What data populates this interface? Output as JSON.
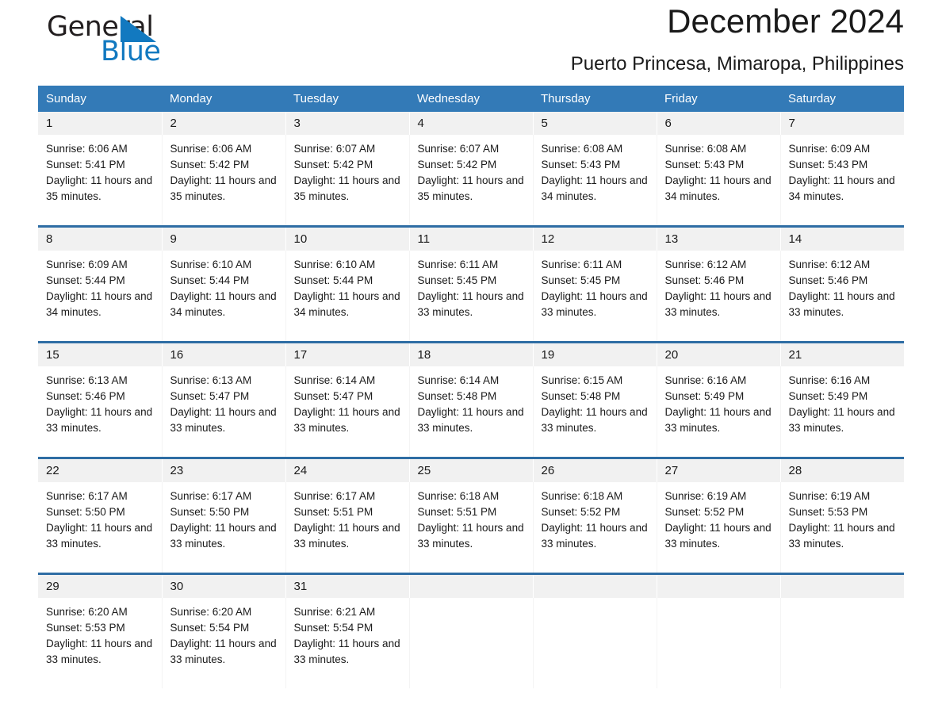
{
  "brand": {
    "name_part1": "General",
    "name_part2": "Blue",
    "triangle_color": "#1279c0",
    "text_color": "#231f20"
  },
  "header": {
    "title": "December 2024",
    "subtitle": "Puerto Princesa, Mimaropa, Philippines"
  },
  "theme": {
    "header_background": "#337ab7",
    "header_text": "#ffffff",
    "week_divider": "#2e6da4",
    "daynum_background": "#f1f1f1",
    "cell_background": "#ffffff",
    "body_text": "#1a1a1a"
  },
  "weekdays": [
    "Sunday",
    "Monday",
    "Tuesday",
    "Wednesday",
    "Thursday",
    "Friday",
    "Saturday"
  ],
  "weeks": [
    {
      "days": [
        {
          "date": "1",
          "sunrise": "Sunrise: 6:06 AM",
          "sunset": "Sunset: 5:41 PM",
          "daylight": "Daylight: 11 hours and 35 minutes."
        },
        {
          "date": "2",
          "sunrise": "Sunrise: 6:06 AM",
          "sunset": "Sunset: 5:42 PM",
          "daylight": "Daylight: 11 hours and 35 minutes."
        },
        {
          "date": "3",
          "sunrise": "Sunrise: 6:07 AM",
          "sunset": "Sunset: 5:42 PM",
          "daylight": "Daylight: 11 hours and 35 minutes."
        },
        {
          "date": "4",
          "sunrise": "Sunrise: 6:07 AM",
          "sunset": "Sunset: 5:42 PM",
          "daylight": "Daylight: 11 hours and 35 minutes."
        },
        {
          "date": "5",
          "sunrise": "Sunrise: 6:08 AM",
          "sunset": "Sunset: 5:43 PM",
          "daylight": "Daylight: 11 hours and 34 minutes."
        },
        {
          "date": "6",
          "sunrise": "Sunrise: 6:08 AM",
          "sunset": "Sunset: 5:43 PM",
          "daylight": "Daylight: 11 hours and 34 minutes."
        },
        {
          "date": "7",
          "sunrise": "Sunrise: 6:09 AM",
          "sunset": "Sunset: 5:43 PM",
          "daylight": "Daylight: 11 hours and 34 minutes."
        }
      ]
    },
    {
      "days": [
        {
          "date": "8",
          "sunrise": "Sunrise: 6:09 AM",
          "sunset": "Sunset: 5:44 PM",
          "daylight": "Daylight: 11 hours and 34 minutes."
        },
        {
          "date": "9",
          "sunrise": "Sunrise: 6:10 AM",
          "sunset": "Sunset: 5:44 PM",
          "daylight": "Daylight: 11 hours and 34 minutes."
        },
        {
          "date": "10",
          "sunrise": "Sunrise: 6:10 AM",
          "sunset": "Sunset: 5:44 PM",
          "daylight": "Daylight: 11 hours and 34 minutes."
        },
        {
          "date": "11",
          "sunrise": "Sunrise: 6:11 AM",
          "sunset": "Sunset: 5:45 PM",
          "daylight": "Daylight: 11 hours and 33 minutes."
        },
        {
          "date": "12",
          "sunrise": "Sunrise: 6:11 AM",
          "sunset": "Sunset: 5:45 PM",
          "daylight": "Daylight: 11 hours and 33 minutes."
        },
        {
          "date": "13",
          "sunrise": "Sunrise: 6:12 AM",
          "sunset": "Sunset: 5:46 PM",
          "daylight": "Daylight: 11 hours and 33 minutes."
        },
        {
          "date": "14",
          "sunrise": "Sunrise: 6:12 AM",
          "sunset": "Sunset: 5:46 PM",
          "daylight": "Daylight: 11 hours and 33 minutes."
        }
      ]
    },
    {
      "days": [
        {
          "date": "15",
          "sunrise": "Sunrise: 6:13 AM",
          "sunset": "Sunset: 5:46 PM",
          "daylight": "Daylight: 11 hours and 33 minutes."
        },
        {
          "date": "16",
          "sunrise": "Sunrise: 6:13 AM",
          "sunset": "Sunset: 5:47 PM",
          "daylight": "Daylight: 11 hours and 33 minutes."
        },
        {
          "date": "17",
          "sunrise": "Sunrise: 6:14 AM",
          "sunset": "Sunset: 5:47 PM",
          "daylight": "Daylight: 11 hours and 33 minutes."
        },
        {
          "date": "18",
          "sunrise": "Sunrise: 6:14 AM",
          "sunset": "Sunset: 5:48 PM",
          "daylight": "Daylight: 11 hours and 33 minutes."
        },
        {
          "date": "19",
          "sunrise": "Sunrise: 6:15 AM",
          "sunset": "Sunset: 5:48 PM",
          "daylight": "Daylight: 11 hours and 33 minutes."
        },
        {
          "date": "20",
          "sunrise": "Sunrise: 6:16 AM",
          "sunset": "Sunset: 5:49 PM",
          "daylight": "Daylight: 11 hours and 33 minutes."
        },
        {
          "date": "21",
          "sunrise": "Sunrise: 6:16 AM",
          "sunset": "Sunset: 5:49 PM",
          "daylight": "Daylight: 11 hours and 33 minutes."
        }
      ]
    },
    {
      "days": [
        {
          "date": "22",
          "sunrise": "Sunrise: 6:17 AM",
          "sunset": "Sunset: 5:50 PM",
          "daylight": "Daylight: 11 hours and 33 minutes."
        },
        {
          "date": "23",
          "sunrise": "Sunrise: 6:17 AM",
          "sunset": "Sunset: 5:50 PM",
          "daylight": "Daylight: 11 hours and 33 minutes."
        },
        {
          "date": "24",
          "sunrise": "Sunrise: 6:17 AM",
          "sunset": "Sunset: 5:51 PM",
          "daylight": "Daylight: 11 hours and 33 minutes."
        },
        {
          "date": "25",
          "sunrise": "Sunrise: 6:18 AM",
          "sunset": "Sunset: 5:51 PM",
          "daylight": "Daylight: 11 hours and 33 minutes."
        },
        {
          "date": "26",
          "sunrise": "Sunrise: 6:18 AM",
          "sunset": "Sunset: 5:52 PM",
          "daylight": "Daylight: 11 hours and 33 minutes."
        },
        {
          "date": "27",
          "sunrise": "Sunrise: 6:19 AM",
          "sunset": "Sunset: 5:52 PM",
          "daylight": "Daylight: 11 hours and 33 minutes."
        },
        {
          "date": "28",
          "sunrise": "Sunrise: 6:19 AM",
          "sunset": "Sunset: 5:53 PM",
          "daylight": "Daylight: 11 hours and 33 minutes."
        }
      ]
    },
    {
      "days": [
        {
          "date": "29",
          "sunrise": "Sunrise: 6:20 AM",
          "sunset": "Sunset: 5:53 PM",
          "daylight": "Daylight: 11 hours and 33 minutes."
        },
        {
          "date": "30",
          "sunrise": "Sunrise: 6:20 AM",
          "sunset": "Sunset: 5:54 PM",
          "daylight": "Daylight: 11 hours and 33 minutes."
        },
        {
          "date": "31",
          "sunrise": "Sunrise: 6:21 AM",
          "sunset": "Sunset: 5:54 PM",
          "daylight": "Daylight: 11 hours and 33 minutes."
        },
        {
          "date": "",
          "sunrise": "",
          "sunset": "",
          "daylight": ""
        },
        {
          "date": "",
          "sunrise": "",
          "sunset": "",
          "daylight": ""
        },
        {
          "date": "",
          "sunrise": "",
          "sunset": "",
          "daylight": ""
        },
        {
          "date": "",
          "sunrise": "",
          "sunset": "",
          "daylight": ""
        }
      ]
    }
  ]
}
